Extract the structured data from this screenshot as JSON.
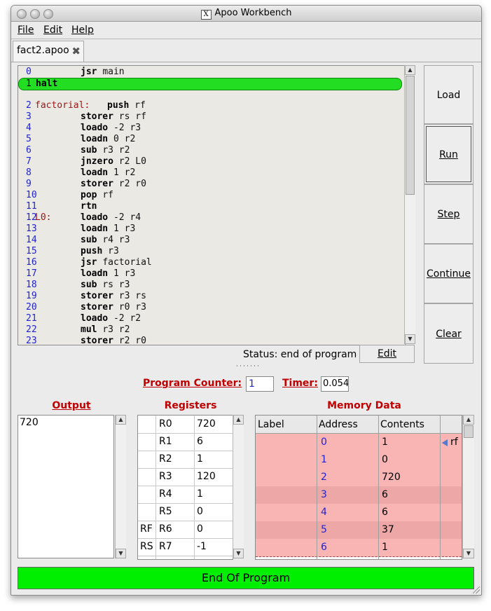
{
  "window": {
    "title": "Apoo Workbench"
  },
  "menu": {
    "file": "File",
    "edit": "Edit",
    "help": "Help"
  },
  "tab": {
    "label": "fact2.apoo"
  },
  "code": {
    "lines": [
      {
        "n": "0",
        "label": "",
        "op": "jsr",
        "args": "main"
      },
      {
        "n": "1",
        "label": "",
        "op": "halt",
        "args": ""
      },
      {
        "n": "2",
        "label": "factorial:",
        "op": "push",
        "args": "rf"
      },
      {
        "n": "3",
        "label": "",
        "op": "storer",
        "args": "rs rf"
      },
      {
        "n": "4",
        "label": "",
        "op": "loado",
        "args": "-2 r3"
      },
      {
        "n": "5",
        "label": "",
        "op": "loadn",
        "args": "0 r2"
      },
      {
        "n": "6",
        "label": "",
        "op": "sub",
        "args": "r3 r2"
      },
      {
        "n": "7",
        "label": "",
        "op": "jnzero",
        "args": "r2 L0"
      },
      {
        "n": "8",
        "label": "",
        "op": "loadn",
        "args": "1 r2"
      },
      {
        "n": "9",
        "label": "",
        "op": "storer",
        "args": "r2 r0"
      },
      {
        "n": "10",
        "label": "",
        "op": "pop",
        "args": "rf"
      },
      {
        "n": "11",
        "label": "",
        "op": "rtn",
        "args": ""
      },
      {
        "n": "12",
        "label": "L0:",
        "op": "loado",
        "args": "-2 r4"
      },
      {
        "n": "13",
        "label": "",
        "op": "loadn",
        "args": "1 r3"
      },
      {
        "n": "14",
        "label": "",
        "op": "sub",
        "args": "r4 r3"
      },
      {
        "n": "15",
        "label": "",
        "op": "push",
        "args": "r3"
      },
      {
        "n": "16",
        "label": "",
        "op": "jsr",
        "args": "factorial"
      },
      {
        "n": "17",
        "label": "",
        "op": "loadn",
        "args": "1 r3"
      },
      {
        "n": "18",
        "label": "",
        "op": "sub",
        "args": "rs r3"
      },
      {
        "n": "19",
        "label": "",
        "op": "storer",
        "args": "r3 rs"
      },
      {
        "n": "20",
        "label": "",
        "op": "storer",
        "args": "r0 r3"
      },
      {
        "n": "21",
        "label": "",
        "op": "loado",
        "args": "-2 r2"
      },
      {
        "n": "22",
        "label": "",
        "op": "mul",
        "args": "r3 r2"
      },
      {
        "n": "23",
        "label": "",
        "op": "storer",
        "args": "r2 r0"
      }
    ]
  },
  "buttons": {
    "load": "Load",
    "run": "Run",
    "step": "Step",
    "continue": "Continue",
    "clear": "Clear",
    "edit": "Edit"
  },
  "status": {
    "text": "Status: end of program"
  },
  "counters": {
    "pc_label": "Program Counter:",
    "pc_value": "1",
    "timer_label": "Timer:",
    "timer_value": "0.054"
  },
  "sections": {
    "output": "Output",
    "registers": "Registers",
    "memory": "Memory Data"
  },
  "output": {
    "text": "720"
  },
  "registers": [
    {
      "alias": "",
      "name": "R0",
      "value": "720"
    },
    {
      "alias": "",
      "name": "R1",
      "value": "6"
    },
    {
      "alias": "",
      "name": "R2",
      "value": "1"
    },
    {
      "alias": "",
      "name": "R3",
      "value": "120"
    },
    {
      "alias": "",
      "name": "R4",
      "value": "1"
    },
    {
      "alias": "",
      "name": "R5",
      "value": "0"
    },
    {
      "alias": "RF",
      "name": "R6",
      "value": "0"
    },
    {
      "alias": "RS",
      "name": "R7",
      "value": "-1"
    }
  ],
  "memory": {
    "headers": {
      "label": "Label",
      "address": "Address",
      "contents": "Contents"
    },
    "rows": [
      {
        "label": "",
        "address": "0",
        "contents": "1",
        "tag": "rf"
      },
      {
        "label": "",
        "address": "1",
        "contents": "0",
        "tag": ""
      },
      {
        "label": "",
        "address": "2",
        "contents": "720",
        "tag": ""
      },
      {
        "label": "",
        "address": "3",
        "contents": "6",
        "tag": ""
      },
      {
        "label": "",
        "address": "4",
        "contents": "6",
        "tag": ""
      },
      {
        "label": "",
        "address": "5",
        "contents": "37",
        "tag": ""
      },
      {
        "label": "",
        "address": "6",
        "contents": "1",
        "tag": ""
      }
    ],
    "row_color": "#f9b4b4",
    "row_color_alt": "#eda7a7"
  },
  "end_banner": {
    "text": "End Of Program",
    "color": "#00ee00"
  }
}
